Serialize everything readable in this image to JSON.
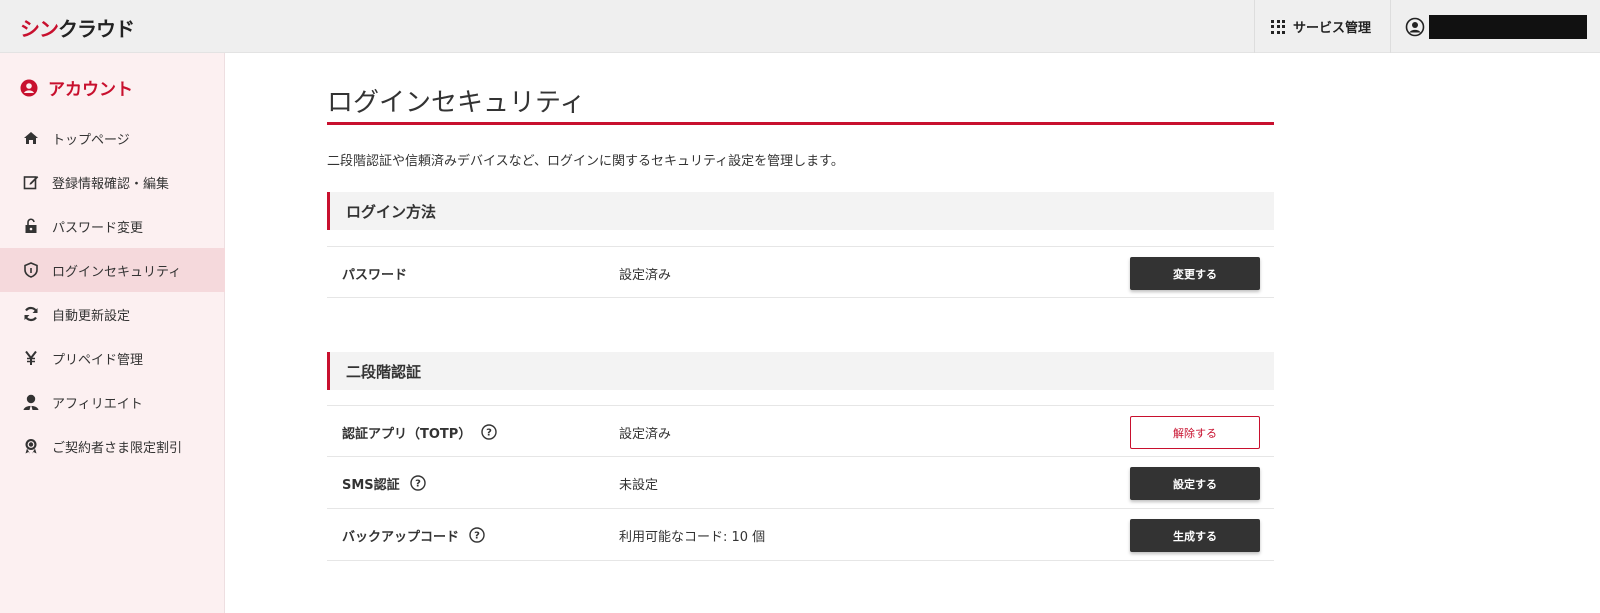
{
  "header": {
    "logo_red": "シン",
    "logo_dark": "クラウド",
    "services_label": "サービス管理"
  },
  "sidebar": {
    "title": "アカウント",
    "items": [
      {
        "label": "トップページ",
        "icon": "home-icon"
      },
      {
        "label": "登録情報確認・編集",
        "icon": "edit-icon"
      },
      {
        "label": "パスワード変更",
        "icon": "unlock-icon"
      },
      {
        "label": "ログインセキュリティ",
        "icon": "shield-icon",
        "active": true
      },
      {
        "label": "自動更新設定",
        "icon": "refresh-icon"
      },
      {
        "label": "プリペイド管理",
        "icon": "yen-icon"
      },
      {
        "label": "アフィリエイト",
        "icon": "person-icon"
      },
      {
        "label": "ご契約者さま限定割引",
        "icon": "badge-icon"
      }
    ]
  },
  "main": {
    "title": "ログインセキュリティ",
    "description": "二段階認証や信頼済みデバイスなど、ログインに関するセキュリティ設定を管理します。",
    "login_method": {
      "heading": "ログイン方法",
      "rows": [
        {
          "label": "パスワード",
          "value": "設定済み",
          "button": "変更する"
        }
      ]
    },
    "two_factor": {
      "heading": "二段階認証",
      "rows": [
        {
          "label": "認証アプリ（TOTP）",
          "value": "設定済み",
          "button": "解除する"
        },
        {
          "label": "SMS認証",
          "value": "未設定",
          "button": "設定する"
        },
        {
          "label": "バックアップコード",
          "value": "利用可能なコード: 10 個",
          "button": "生成する"
        }
      ]
    }
  },
  "colors": {
    "accent": "#c8102e",
    "sidebar_bg": "#fcf0f1",
    "sidebar_active": "#f5d9dc",
    "button_dark": "#333333"
  }
}
